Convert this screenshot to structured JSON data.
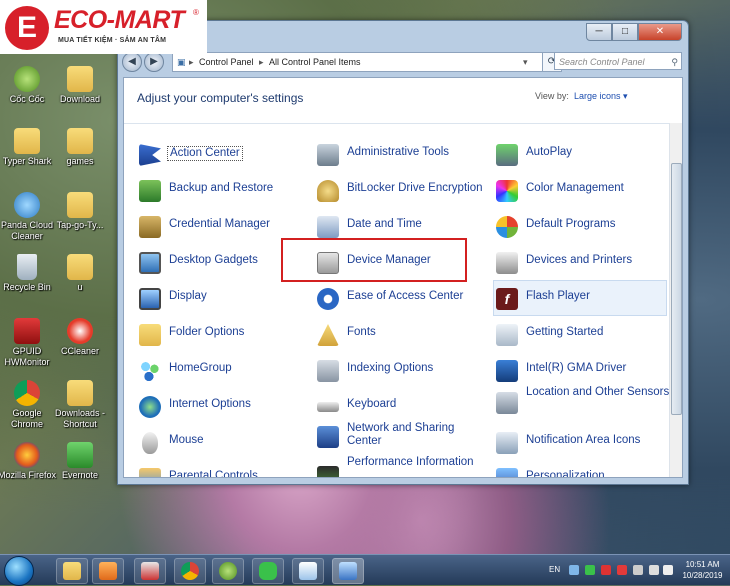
{
  "logo": {
    "mark": "E",
    "name": "ECO-MART",
    "reg": "®",
    "tagline": "MUA TIẾT KIỆM · SẮM AN TÂM"
  },
  "desktop_icons": [
    {
      "label": "Cốc Cốc"
    },
    {
      "label": "Download"
    },
    {
      "label": "Typer Shark"
    },
    {
      "label": "games"
    },
    {
      "label": "Panda Cloud Cleaner"
    },
    {
      "label": "Tap-go-Ty..."
    },
    {
      "label": "Recycle Bin"
    },
    {
      "label": "u"
    },
    {
      "label": "GPUID HWMonitor"
    },
    {
      "label": "CCleaner"
    },
    {
      "label": "Google Chrome"
    },
    {
      "label": "Downloads - Shortcut"
    },
    {
      "label": "Mozilla Firefox"
    },
    {
      "label": "Evernote"
    }
  ],
  "window": {
    "buttons": {
      "minimize": "─",
      "maximize": "□",
      "close": "✕"
    },
    "address": {
      "root": "Control Panel",
      "sep": "▸",
      "current": "All Control Panel Items"
    },
    "search_placeholder": "Search Control Panel",
    "heading": "Adjust your computer's settings",
    "view_by_label": "View by:",
    "view_by_value": "Large icons ▾"
  },
  "items": [
    {
      "label": "Action Center"
    },
    {
      "label": "Administrative Tools"
    },
    {
      "label": "AutoPlay"
    },
    {
      "label": "Backup and Restore"
    },
    {
      "label": "BitLocker Drive Encryption"
    },
    {
      "label": "Color Management"
    },
    {
      "label": "Credential Manager"
    },
    {
      "label": "Date and Time"
    },
    {
      "label": "Default Programs"
    },
    {
      "label": "Desktop Gadgets"
    },
    {
      "label": "Device Manager"
    },
    {
      "label": "Devices and Printers"
    },
    {
      "label": "Display"
    },
    {
      "label": "Ease of Access Center"
    },
    {
      "label": "Flash Player"
    },
    {
      "label": "Folder Options"
    },
    {
      "label": "Fonts"
    },
    {
      "label": "Getting Started"
    },
    {
      "label": "HomeGroup"
    },
    {
      "label": "Indexing Options"
    },
    {
      "label": "Intel(R) GMA Driver"
    },
    {
      "label": "Internet Options"
    },
    {
      "label": "Keyboard"
    },
    {
      "label": "Location and Other Sensors"
    },
    {
      "label": "Mouse"
    },
    {
      "label": "Network and Sharing Center"
    },
    {
      "label": "Notification Area Icons"
    },
    {
      "label": "Parental Controls"
    },
    {
      "label": "Performance Information"
    },
    {
      "label": "Personalization"
    }
  ],
  "taskbar": {
    "language": "EN",
    "time": "10:51 AM",
    "date": "10/28/2019"
  },
  "colors": {
    "accent_link": "#1c3f94",
    "highlight_border": "#d32020",
    "brand_red": "#d7202a"
  }
}
